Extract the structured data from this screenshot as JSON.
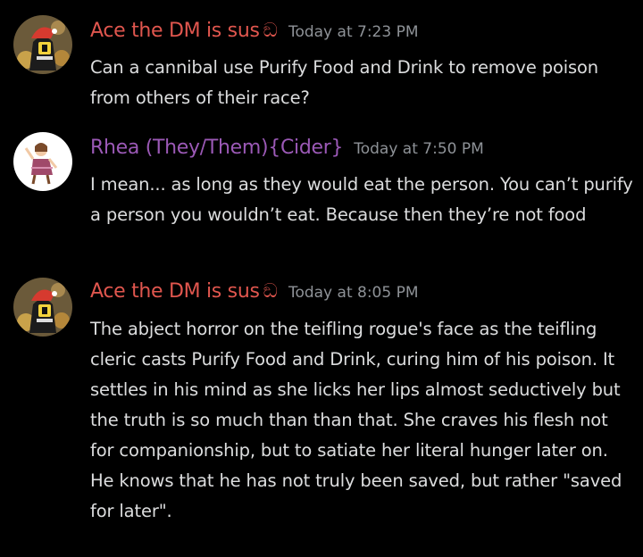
{
  "colors": {
    "background": "#000000",
    "ace_name": "#e0564e",
    "rhea_name": "#9b59b6",
    "timestamp": "#8e9297",
    "body_text": "#dcddde"
  },
  "messages": [
    {
      "author": "Ace the DM is sus",
      "author_icon": "ඞ",
      "avatar_icon": "ace-avatar-icon",
      "timestamp": "Today at 7:23 PM",
      "text": "Can a cannibal use Purify Food and Drink to remove poison from others of their race?"
    },
    {
      "author": "Rhea (They/Them){Cider}",
      "avatar_icon": "rhea-avatar-icon",
      "timestamp": "Today at 7:50 PM",
      "text": "I mean... as long as they would eat the person. You can’t purify a person you wouldn’t eat. Because then they’re not food"
    },
    {
      "author": "Ace the DM is sus",
      "author_icon": "ඞ",
      "avatar_icon": "ace-avatar-icon",
      "timestamp": "Today at 8:05 PM",
      "text": "The abject horror on the teifling rogue's face as the teifling cleric casts Purify Food and Drink, curing him of his poison. It settles in his mind as she licks her lips almost seductively but the truth is so much than than that. She craves his flesh not for companionship, but to satiate her literal hunger later on. He knows that he has not truly been saved, but rather \"saved for later\"."
    }
  ]
}
